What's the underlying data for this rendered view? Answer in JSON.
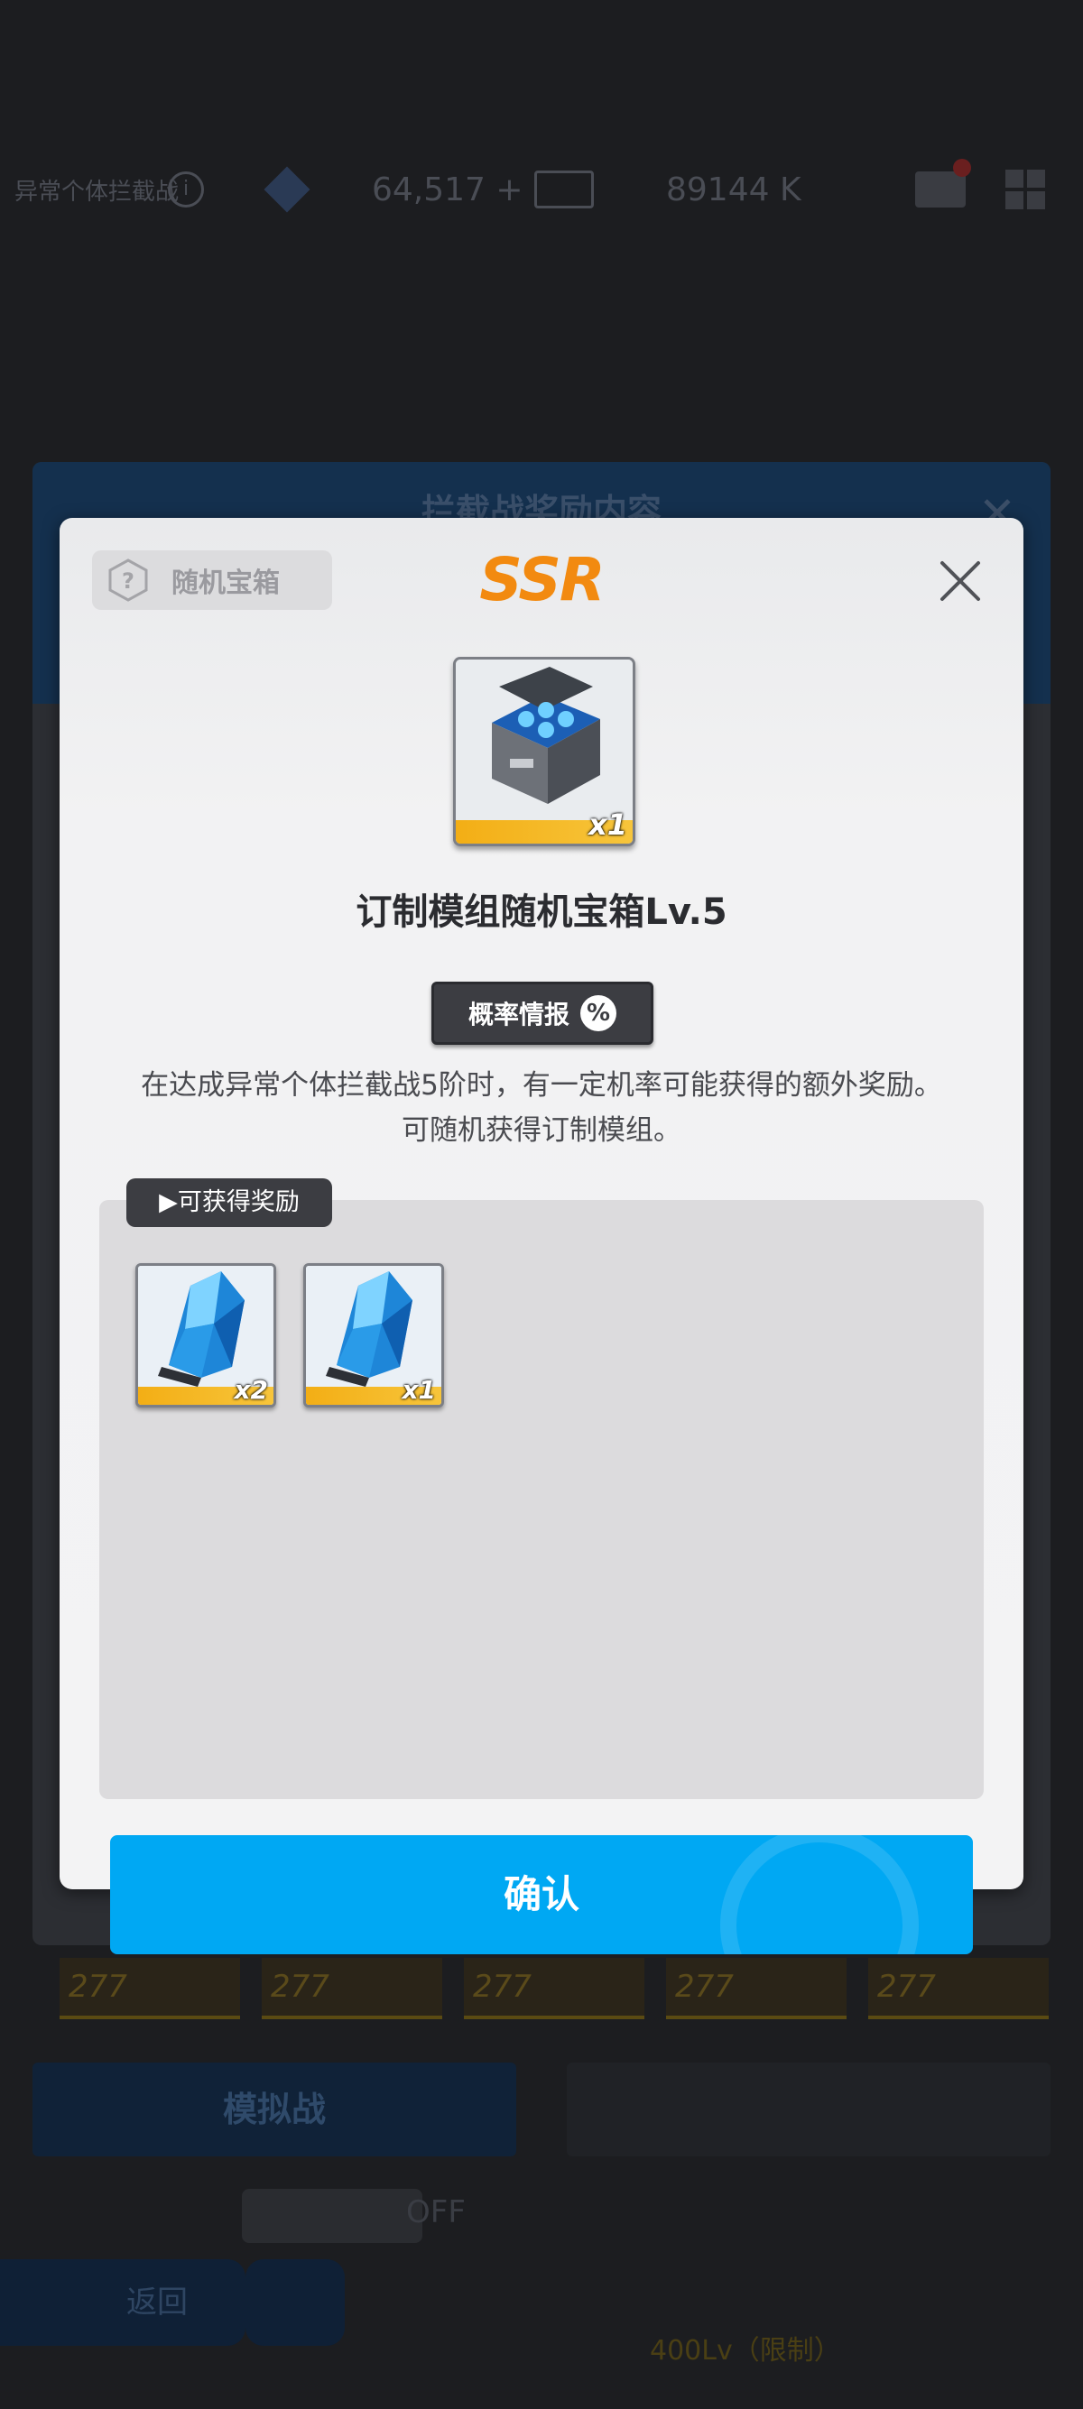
{
  "background": {
    "mode_label": "异常个体拦截战",
    "gems": "64,517 +",
    "credits": "89144 K",
    "panel_title": "拦截战奖励内容",
    "char_levels": [
      "277",
      "277",
      "277",
      "277",
      "277"
    ],
    "simulate_label": "模拟战",
    "toggle_off_label": "OFF",
    "back_label": "返回",
    "level_limit": "400Lv（限制）"
  },
  "dialog": {
    "category": "随机宝箱",
    "rarity": "SSR",
    "item": {
      "name": "订制模组随机宝箱Lv.5",
      "quantity": "x1",
      "icon": "blue-crate-icon"
    },
    "probability_button": "概率情报",
    "probability_icon_glyph": "%",
    "description_line1": "在达成异常个体拦截战5阶时，有一定机率可能获得的额外奖励。",
    "description_line2": "可随机获得订制模组。",
    "rewards_header": "▶可获得奖励",
    "rewards": [
      {
        "icon": "blue-crystal-icon",
        "quantity": "x2"
      },
      {
        "icon": "blue-crystal-icon",
        "quantity": "x1"
      }
    ],
    "confirm_label": "确认"
  },
  "colors": {
    "rarity": "#f28a10",
    "confirm": "#00a8f3",
    "rarity_stripe": "#f3ae15"
  }
}
